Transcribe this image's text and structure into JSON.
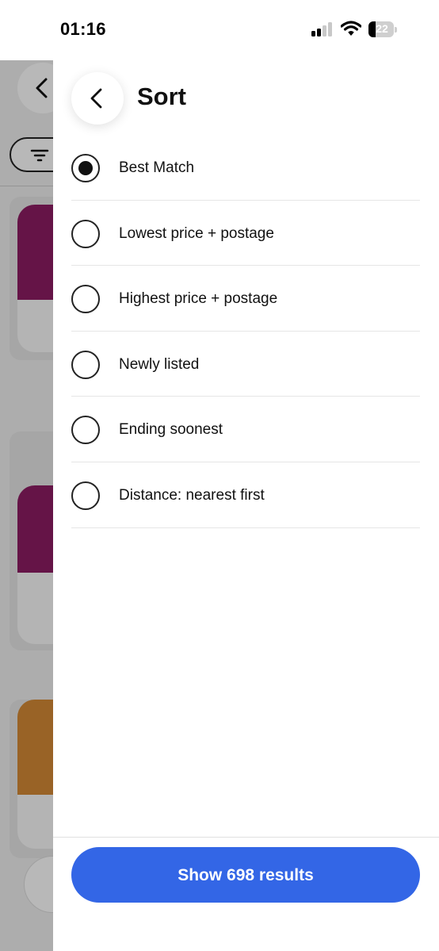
{
  "status_bar": {
    "time": "01:16",
    "battery_level": "22",
    "icons": [
      "cellular-signal-icon",
      "wifi-icon",
      "battery-icon"
    ]
  },
  "background": {
    "icons": [
      "chevron-left-icon",
      "filter-icon"
    ],
    "overlay_color": "rgba(0,0,0,0.28)"
  },
  "sort_panel": {
    "title": "Sort",
    "back_icon": "chevron-left-icon",
    "selected_index": 0,
    "options": [
      {
        "label": "Best Match"
      },
      {
        "label": "Lowest price + postage"
      },
      {
        "label": "Highest price + postage"
      },
      {
        "label": "Newly listed"
      },
      {
        "label": "Ending soonest"
      },
      {
        "label": "Distance: nearest first"
      }
    ],
    "show_results_label": "Show 698 results"
  },
  "colors": {
    "accent": "#3366e6",
    "text": "#111111",
    "divider": "#e6e6e6",
    "badge_red": "#e53238"
  }
}
